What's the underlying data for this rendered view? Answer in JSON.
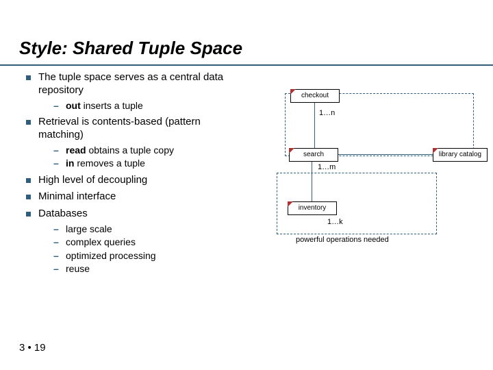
{
  "title": "Style: Shared Tuple Space",
  "bullets": {
    "b1": "The tuple space serves as a central data repository",
    "b1_sub1_prefix": "out",
    "b1_sub1_rest": " inserts a tuple",
    "b2": "Retrieval is contents-based (pattern matching)",
    "b2_sub1_prefix": "read",
    "b2_sub1_rest": " obtains a tuple copy",
    "b2_sub2_prefix": "in",
    "b2_sub2_rest": " removes a tuple",
    "b3": "High level of decoupling",
    "b4": "Minimal interface",
    "b5": "Databases",
    "b5_sub1": "large scale",
    "b5_sub2": "complex queries",
    "b5_sub3": "optimized processing",
    "b5_sub4": "reuse"
  },
  "diagram": {
    "checkout": "checkout",
    "search": "search",
    "catalog": "library catalog",
    "inventory": "inventory",
    "range_1n": "1…n",
    "range_1m": "1…m",
    "range_1k": "1…k",
    "note": "powerful operations needed"
  },
  "footer": "3 • 19"
}
